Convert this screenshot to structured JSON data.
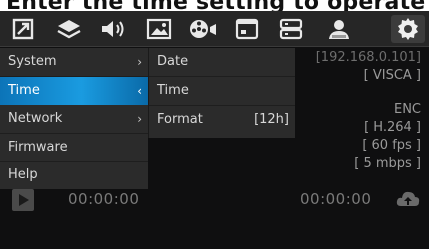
{
  "header": {
    "title": "Enter the time setting to operate"
  },
  "toolbar": {
    "icons": [
      "aspect-icon",
      "layers-icon",
      "volume-icon",
      "image-icon",
      "camera-reel-icon",
      "display-icon",
      "storage-icon",
      "user-icon",
      "settings-icon"
    ],
    "active_icon": "settings-icon"
  },
  "status": {
    "ip": "[192.168.0.101]",
    "protocol": "[ VISCA ]",
    "enc_label": "ENC",
    "codec": "[ H.264 ]",
    "fps": "[ 60 fps ]",
    "bitrate": "[ 5 mbps ]"
  },
  "playback": {
    "timecode_left": "00:00:00",
    "timecode_right": "00:00:00"
  },
  "menu": {
    "items": [
      {
        "label": "System",
        "arrow": "›"
      },
      {
        "label": "Time",
        "arrow": "‹"
      },
      {
        "label": "Network",
        "arrow": "›"
      },
      {
        "label": "Firmware",
        "arrow": ""
      },
      {
        "label": "Help",
        "arrow": ""
      }
    ],
    "selected": "Time",
    "submenu": [
      {
        "label": "Date",
        "value": ""
      },
      {
        "label": "Time",
        "value": ""
      },
      {
        "label": "Format",
        "value": "[12h]"
      }
    ]
  },
  "colors": {
    "highlight": "#1a9be0",
    "panel": "#2b2b2b",
    "background": "#0f0f10"
  }
}
